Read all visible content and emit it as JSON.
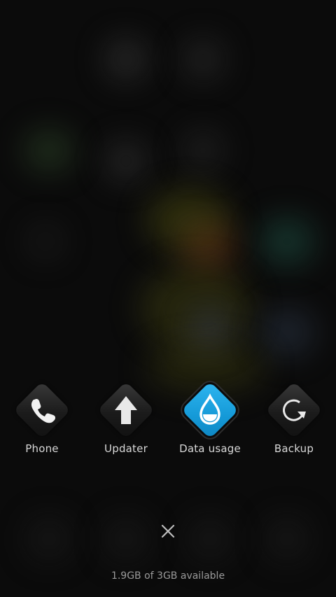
{
  "recent_apps": [
    {
      "label": "Phone",
      "icon": "phone-icon"
    },
    {
      "label": "Updater",
      "icon": "up-arrow-icon"
    },
    {
      "label": "Data usage",
      "icon": "water-drop-icon"
    },
    {
      "label": "Backup",
      "icon": "refresh-icon"
    }
  ],
  "memory_text": "1.9GB of 3GB available",
  "colors": {
    "accent": "#1aa3e0",
    "background": "#0b0b0b",
    "label": "#d8d8d8"
  }
}
